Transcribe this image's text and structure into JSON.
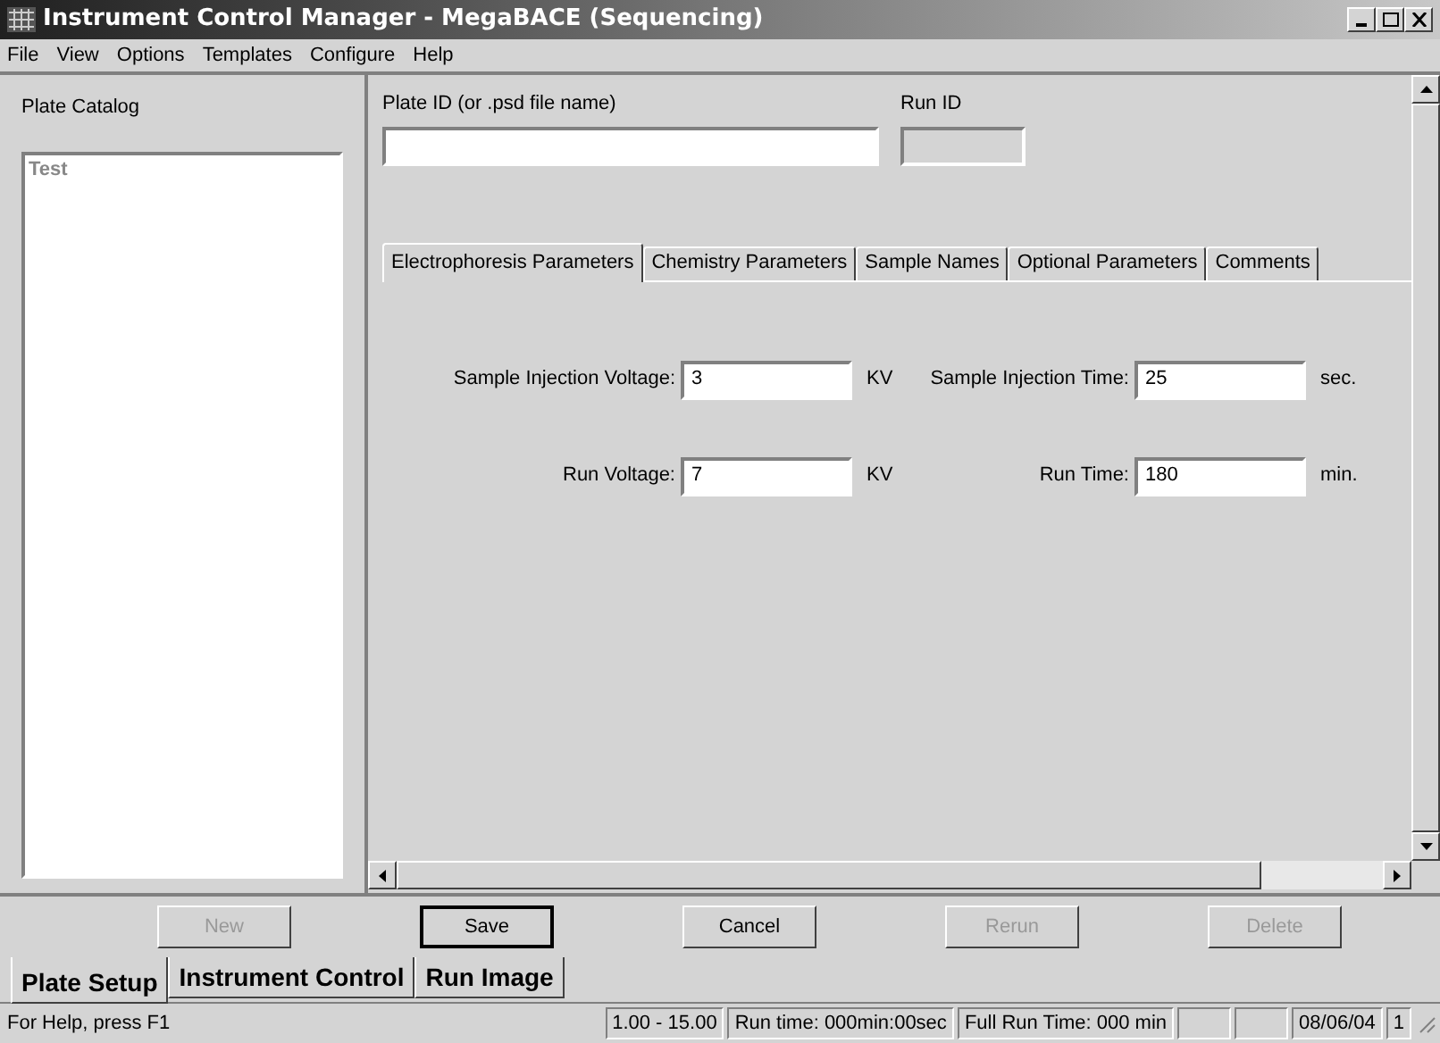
{
  "window": {
    "title": "Instrument Control Manager - MegaBACE (Sequencing)"
  },
  "menu": [
    "File",
    "View",
    "Options",
    "Templates",
    "Configure",
    "Help"
  ],
  "plate_catalog": {
    "label": "Plate Catalog",
    "items": [
      {
        "label": "Test",
        "selected": false
      }
    ]
  },
  "plate_id": {
    "label": "Plate ID (or .psd file name)"
  },
  "run_id": {
    "label": "Run ID",
    "disabled": true
  },
  "tabs": [
    {
      "label": "Electrophoresis Parameters",
      "selected": true
    },
    {
      "label": "Chemistry Parameters",
      "selected": false
    },
    {
      "label": "Sample Names",
      "selected": false
    },
    {
      "label": "Optional Parameters",
      "selected": false
    },
    {
      "label": "Comments",
      "selected": false
    }
  ],
  "parameters": [
    {
      "label": "Sample Injection Voltage:",
      "value": "3",
      "unit": "KV"
    },
    {
      "label": "Sample Injection Time:",
      "value": "25",
      "unit": "sec."
    },
    {
      "label": "Run Voltage:",
      "value": "7",
      "unit": "KV"
    },
    {
      "label": "Run Time:",
      "value": "180",
      "unit": "min."
    }
  ],
  "buttons": [
    {
      "label": "New",
      "disabled": true,
      "default": false
    },
    {
      "label": "Save",
      "disabled": false,
      "default": true
    },
    {
      "label": "Cancel",
      "disabled": false,
      "default": false
    },
    {
      "label": "Rerun",
      "disabled": true,
      "default": false
    },
    {
      "label": "Delete",
      "disabled": true,
      "default": false
    }
  ],
  "bottom_tabs": [
    {
      "label": "Plate Setup",
      "selected": true
    },
    {
      "label": "Instrument Control",
      "selected": false
    },
    {
      "label": "Run Image",
      "selected": false
    }
  ],
  "status_bar": {
    "help": "For Help, press F1",
    "panes": [
      "1.00 - 15.00",
      "Run time: 000min:00sec",
      "Full Run Time: 000 min"
    ],
    "date": "08/06/04",
    "page": "1"
  }
}
